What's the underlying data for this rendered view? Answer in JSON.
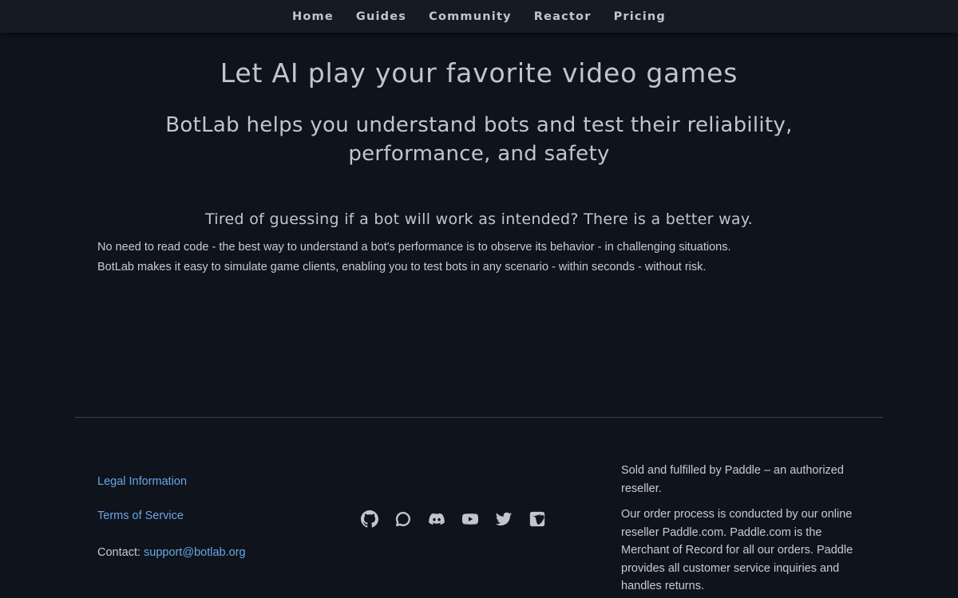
{
  "nav": {
    "items": [
      "Home",
      "Guides",
      "Community",
      "Reactor",
      "Pricing"
    ]
  },
  "hero": {
    "title": "Let AI play your favorite video games",
    "subtitle": "BotLab helps you understand bots and test their reliability, performance, and safety"
  },
  "pitch": {
    "heading": "Tired of guessing if a bot will work as intended? There is a better way.",
    "line1": "No need to read code - the best way to understand a bot's performance is to observe its behavior - in challenging situations.",
    "line2": "BotLab makes it easy to simulate game clients, enabling you to test bots in any scenario - within seconds - without risk."
  },
  "footer": {
    "legal_label": "Legal Information",
    "tos_label": "Terms of Service",
    "contact_label": "Contact: ",
    "contact_email": "support@botlab.org",
    "social_icons": [
      "github-icon",
      "chat-bubble-icon",
      "discord-icon",
      "youtube-icon",
      "twitter-icon",
      "vimeo-icon"
    ],
    "reseller_p1": "Sold and fulfilled by Paddle – an authorized reseller.",
    "reseller_p2": "Our order process is conducted by our online reseller Paddle.com. Paddle.com is the Merchant of Record for all our orders. Paddle provides all customer service inquiries and handles returns."
  },
  "colors": {
    "background": "#0f131b",
    "nav_background": "#161a22",
    "text": "#c9cbcf",
    "link": "#6aa6e8",
    "divider": "#3a3f49"
  }
}
